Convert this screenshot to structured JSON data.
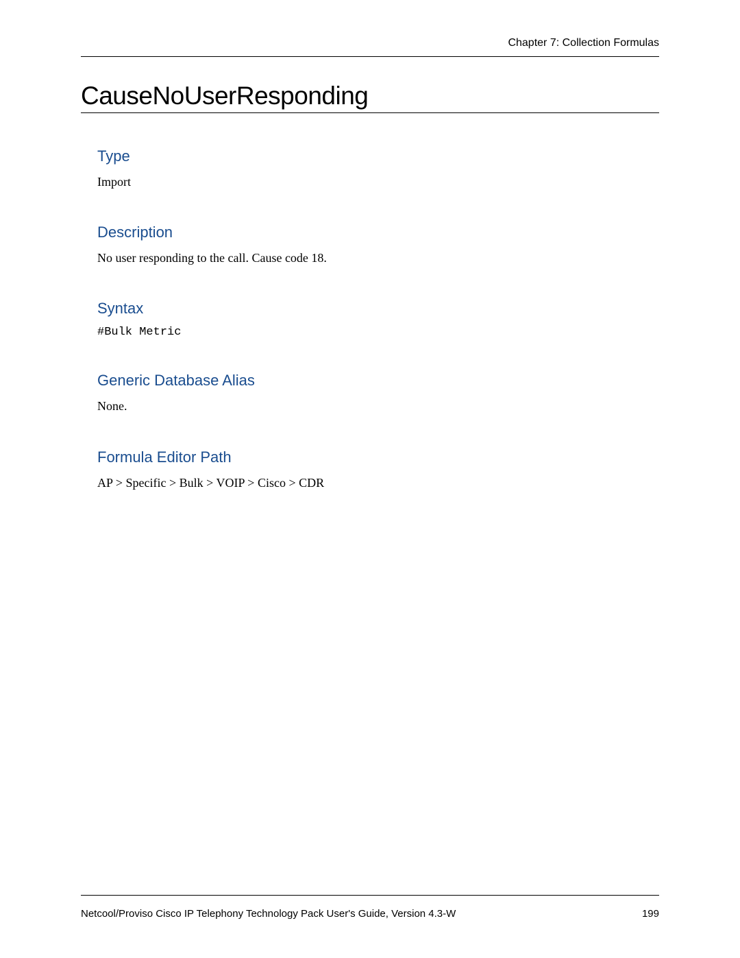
{
  "header": {
    "chapter": "Chapter 7: Collection Formulas"
  },
  "title": "CauseNoUserResponding",
  "sections": {
    "type": {
      "heading": "Type",
      "body": "Import"
    },
    "description": {
      "heading": "Description",
      "body": "No user responding to the call. Cause code 18."
    },
    "syntax": {
      "heading": "Syntax",
      "body": "#Bulk Metric"
    },
    "alias": {
      "heading": "Generic Database Alias",
      "body": "None."
    },
    "path": {
      "heading": "Formula Editor Path",
      "body": "AP > Specific > Bulk > VOIP > Cisco > CDR"
    }
  },
  "footer": {
    "left": "Netcool/Proviso Cisco IP Telephony Technology Pack User's Guide, Version 4.3-W",
    "right": "199"
  }
}
